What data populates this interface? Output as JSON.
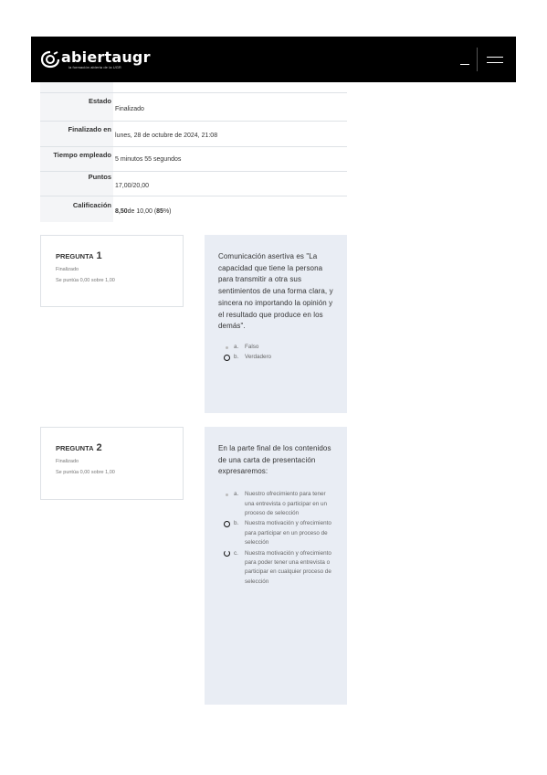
{
  "header": {
    "logo_name": "abiertaugr",
    "logo_tagline": "la formación abierta de la UGR"
  },
  "summary": {
    "rows": [
      {
        "label": "Estado",
        "value": "Finalizado"
      },
      {
        "label": "Finalizado en",
        "value": "lunes, 28 de octubre de 2024, 21:08"
      },
      {
        "label": "Tiempo empleado",
        "value": "5 minutos 55 segundos"
      },
      {
        "label": "Puntos",
        "value": "17,00/20,00"
      },
      {
        "label": "Calificación",
        "value_bold": "8,50",
        "value_mid": " de 10,00 (",
        "value_pct": "85",
        "value_end": "%)"
      }
    ]
  },
  "questions": [
    {
      "label": "PREGUNTA",
      "number": "1",
      "status": "Finalizado",
      "grade": "Se puntúa 0,00 sobre 1,00",
      "text": "Comunicación asertiva es \"La capacidad que tiene la persona para transmitir a otra sus sentimientos de una forma clara, y sincera no importando la opinión y el resultado que produce en los demás\".",
      "answers": [
        {
          "letter": "a.",
          "text": "Falso",
          "selected": false
        },
        {
          "letter": "b.",
          "text": "Verdadero",
          "selected": true
        }
      ]
    },
    {
      "label": "PREGUNTA",
      "number": "2",
      "status": "Finalizado",
      "grade": "Se puntúa 0,00 sobre 1,00",
      "text": "En la parte final de los contenidos de una carta de presentación expresaremos:",
      "answers": [
        {
          "letter": "a.",
          "text": "Nuestro ofrecimiento para tener una entrevista o participar en un proceso de selección",
          "selected": false
        },
        {
          "letter": "b.",
          "text": "Nuestra motivación y ofrecimiento para participar en un proceso de selección",
          "selected": true
        },
        {
          "letter": "c.",
          "text": "Nuestra motivación y ofrecimiento para poder tener una entrevista o participar en cualquier proceso de selección",
          "selected": true
        }
      ]
    }
  ],
  "colors": {
    "topbar": "#000000",
    "summary_header_bg": "#f4f5f7",
    "question_panel_bg": "#e9edf4",
    "border": "#dee2e6"
  }
}
